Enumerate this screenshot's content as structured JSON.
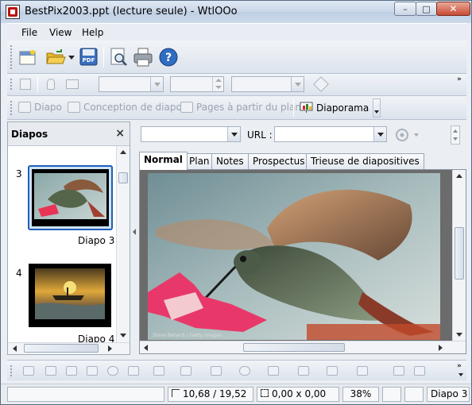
{
  "window": {
    "title": "BestPix2003.ppt (lecture seule) - WtlOOo",
    "controls": {
      "minimize": "–",
      "maximize": "□",
      "close": "✕"
    }
  },
  "menu": {
    "items": [
      "File",
      "View",
      "Help"
    ]
  },
  "toolbar3": {
    "items": [
      {
        "label": "Diapo",
        "enabled": false
      },
      {
        "label": "Conception de diapo",
        "enabled": false
      },
      {
        "label": "Pages à partir du plan",
        "enabled": false
      },
      {
        "label": "Diaporama",
        "enabled": true
      }
    ]
  },
  "slides_pane": {
    "title": "Diapos",
    "close_glyph": "×",
    "slides": [
      {
        "number": "3",
        "caption": "Diapo 3",
        "selected": true
      },
      {
        "number": "4",
        "caption": "Diapo 4",
        "selected": false
      }
    ]
  },
  "url_bar": {
    "label": "URL :",
    "value": ""
  },
  "tabs": [
    "Normal",
    "Plan",
    "Notes",
    "Prospectus",
    "Trieuse de diapositives"
  ],
  "active_tab": "Normal",
  "slide": {
    "credit": "Steve Berardi / Getty Images"
  },
  "status_bar": {
    "position": "10,68 / 19,52",
    "size": "0,00 x 0,00",
    "zoom": "38%",
    "slide": "Diapo 3"
  },
  "colors": {
    "accent": "#1f5fb8",
    "titlebar": "#c9d7e8",
    "close_button": "#c84b34"
  }
}
